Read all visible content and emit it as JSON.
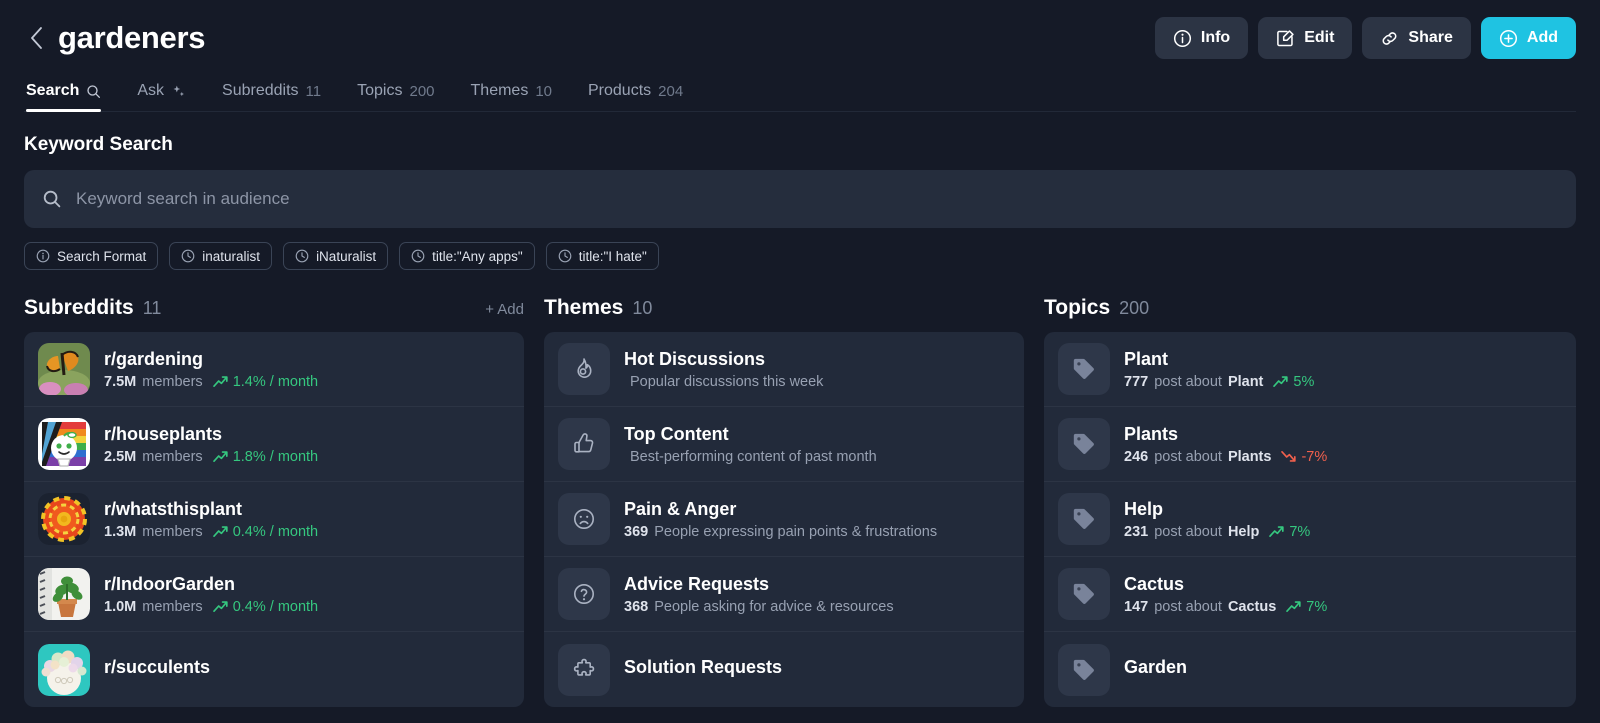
{
  "header": {
    "back_icon": "chevron-left-icon",
    "title": "gardeners",
    "actions": [
      {
        "label": "Info",
        "icon": "info-circle-icon",
        "primary": false
      },
      {
        "label": "Edit",
        "icon": "edit-square-icon",
        "primary": false
      },
      {
        "label": "Share",
        "icon": "link-icon",
        "primary": false
      },
      {
        "label": "Add",
        "icon": "plus-circle-icon",
        "primary": true
      }
    ],
    "accent_color": "#1fc3e2"
  },
  "tabs": [
    {
      "label": "Search",
      "count": "",
      "icon": "search-icon",
      "active": true
    },
    {
      "label": "Ask",
      "count": "",
      "icon": "sparkles-icon",
      "active": false
    },
    {
      "label": "Subreddits",
      "count": "11",
      "icon": "",
      "active": false
    },
    {
      "label": "Topics",
      "count": "200",
      "icon": "",
      "active": false
    },
    {
      "label": "Themes",
      "count": "10",
      "icon": "",
      "active": false
    },
    {
      "label": "Products",
      "count": "204",
      "icon": "",
      "active": false
    }
  ],
  "search": {
    "section_title": "Keyword Search",
    "placeholder": "Keyword search in audience",
    "value": "",
    "icon": "search-icon",
    "chips": [
      {
        "label": "Search Format",
        "icon": "info-circle-icon"
      },
      {
        "label": "inaturalist",
        "icon": "clock-icon"
      },
      {
        "label": "iNaturalist",
        "icon": "clock-icon"
      },
      {
        "label": "title:\"Any apps\"",
        "icon": "clock-icon"
      },
      {
        "label": "title:\"I hate\"",
        "icon": "clock-icon"
      }
    ]
  },
  "subreddits": {
    "heading": "Subreddits",
    "count": "11",
    "add_label": "+ Add",
    "items": [
      {
        "name": "r/gardening",
        "members": "7.5M",
        "members_label": "members",
        "growth": "1.4% / month",
        "direction": "up",
        "avatar": "butterfly-photo"
      },
      {
        "name": "r/houseplants",
        "members": "2.5M",
        "members_label": "members",
        "growth": "1.8% / month",
        "direction": "up",
        "avatar": "rainbow-snoo"
      },
      {
        "name": "r/whatsthisplant",
        "members": "1.3M",
        "members_label": "members",
        "growth": "0.4% / month",
        "direction": "up",
        "avatar": "marigold-photo"
      },
      {
        "name": "r/IndoorGarden",
        "members": "1.0M",
        "members_label": "members",
        "growth": "0.4% / month",
        "direction": "up",
        "avatar": "potted-plant-photo"
      },
      {
        "name": "r/succulents",
        "members": "",
        "members_label": "",
        "growth": "",
        "direction": "up",
        "avatar": "floral-snoo"
      }
    ]
  },
  "themes": {
    "heading": "Themes",
    "count": "10",
    "items": [
      {
        "title": "Hot Discussions",
        "count": "",
        "desc": "Popular discussions this week",
        "icon": "flame-icon"
      },
      {
        "title": "Top Content",
        "count": "",
        "desc": "Best-performing content of past month",
        "icon": "thumbs-up-icon"
      },
      {
        "title": "Pain & Anger",
        "count": "369",
        "desc": "People expressing pain points & frustrations",
        "icon": "sad-face-icon"
      },
      {
        "title": "Advice Requests",
        "count": "368",
        "desc": "People asking for advice & resources",
        "icon": "question-circle-icon"
      },
      {
        "title": "Solution Requests",
        "count": "",
        "desc": "",
        "icon": "puzzle-piece-icon"
      }
    ]
  },
  "topics": {
    "heading": "Topics",
    "count": "200",
    "items": [
      {
        "name": "Plant",
        "posts": "777",
        "mid": "post about",
        "keyword": "Plant",
        "growth": "5%",
        "direction": "up",
        "icon": "tag-icon"
      },
      {
        "name": "Plants",
        "posts": "246",
        "mid": "post about",
        "keyword": "Plants",
        "growth": "-7%",
        "direction": "down",
        "icon": "tag-icon"
      },
      {
        "name": "Help",
        "posts": "231",
        "mid": "post about",
        "keyword": "Help",
        "growth": "7%",
        "direction": "up",
        "icon": "tag-icon"
      },
      {
        "name": "Cactus",
        "posts": "147",
        "mid": "post about",
        "keyword": "Cactus",
        "growth": "7%",
        "direction": "up",
        "icon": "tag-icon"
      },
      {
        "name": "Garden",
        "posts": "",
        "mid": "",
        "keyword": "",
        "growth": "",
        "direction": "up",
        "icon": "tag-icon"
      }
    ]
  },
  "colors": {
    "page_bg": "#151a27",
    "card_bg": "#222a3a",
    "input_bg": "#252d3d",
    "accent": "#1fc3e2",
    "up": "#35c77f",
    "down": "#f0604d"
  }
}
